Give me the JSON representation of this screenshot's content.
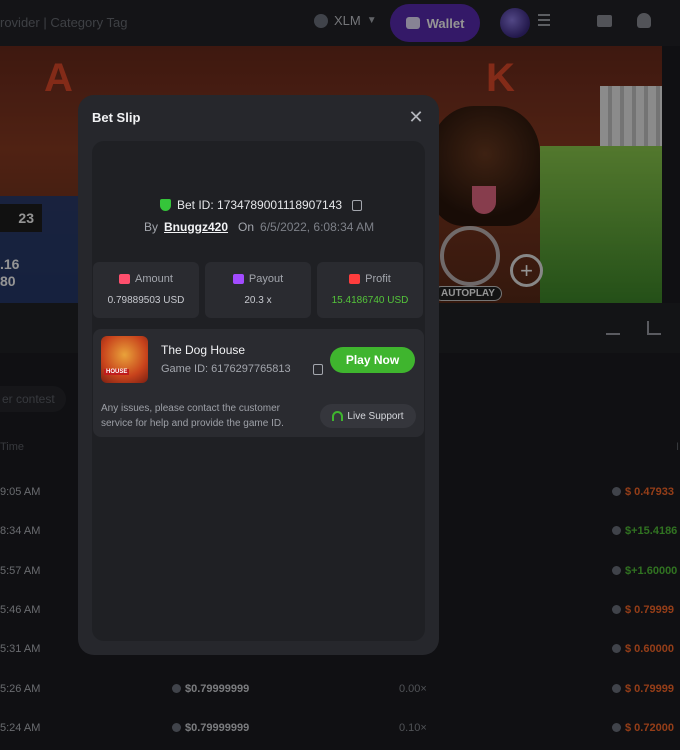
{
  "header": {
    "search_hint": "rovider | Category Tag",
    "currency": "XLM",
    "wallet_label": "Wallet"
  },
  "banner": {
    "letters": [
      "A",
      "K"
    ],
    "reel_value": "23",
    "side_values": [
      ".16",
      "80"
    ],
    "autoplay_label": "AUTOPLAY"
  },
  "background": {
    "contest_placeholder": "er contest",
    "time_header": "Time",
    "right_header": "I",
    "rows": [
      {
        "time": "9:05 AM",
        "amount": "",
        "payout": "",
        "profit": "$ 0.47933",
        "profit_color": "#ff6a2a"
      },
      {
        "time": "8:34 AM",
        "amount": "",
        "payout": "",
        "profit": "$+15.4186",
        "profit_color": "#54c43a"
      },
      {
        "time": "5:57 AM",
        "amount": "",
        "payout": "",
        "profit": "$+1.60000",
        "profit_color": "#54c43a"
      },
      {
        "time": "5:46 AM",
        "amount": "",
        "payout": "",
        "profit": "$ 0.79999",
        "profit_color": "#ff6a2a"
      },
      {
        "time": "5:31 AM",
        "amount": "",
        "payout": "",
        "profit": "$ 0.60000",
        "profit_color": "#ff6a2a"
      },
      {
        "time": "5:26 AM",
        "amount": "$0.79999999",
        "payout": "0.00×",
        "profit": "$ 0.79999",
        "profit_color": "#ff6a2a"
      },
      {
        "time": "5:24 AM",
        "amount": "$0.79999999",
        "payout": "0.10×",
        "profit": "$ 0.72000",
        "profit_color": "#ff6a2a"
      }
    ]
  },
  "modal": {
    "title": "Bet Slip",
    "bet_id_label": "Bet ID: 1734789001118907143",
    "by_label": "By",
    "username": "Bnuggz420",
    "on_label": "On",
    "date": "6/5/2022, 6:08:34 AM",
    "stats": [
      {
        "label": "Amount",
        "value": "0.79889503 USD",
        "icon": "amount-icon",
        "icon_color": "#ff4f6d",
        "value_color": "#c7c9cf"
      },
      {
        "label": "Payout",
        "value": "20.3 x",
        "icon": "payout-icon",
        "icon_color": "#a24bff",
        "value_color": "#c7c9cf"
      },
      {
        "label": "Profit",
        "value": "15.4186740 USD",
        "icon": "profit-icon",
        "icon_color": "#ff3d3d",
        "value_color": "#54c43a"
      }
    ],
    "game": {
      "name": "The Dog House",
      "id_label": "Game ID: 6176297765813",
      "thumb_text": "HOUSE",
      "play_label": "Play Now"
    },
    "notice": "Any issues, please contact the customer service for help and provide the game ID.",
    "support_label": "Live Support"
  }
}
